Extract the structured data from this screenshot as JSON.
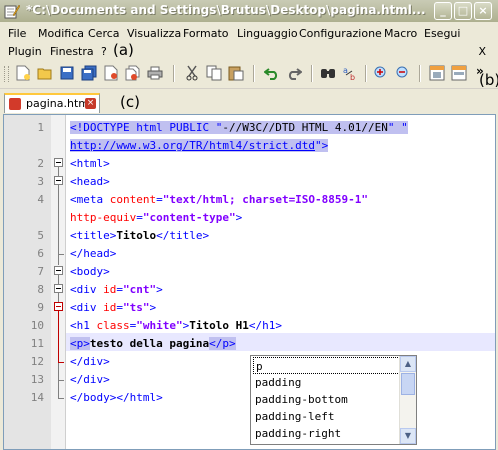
{
  "window": {
    "title": "*C:\\Documents and Settings\\Brutus\\Desktop\\pagina.html..."
  },
  "menu": {
    "items": [
      "File",
      "Modifica",
      "Cerca",
      "Visualizza",
      "Formato",
      "Linguaggio",
      "Configurazione",
      "Macro",
      "Esegui",
      "Plugin",
      "Finestra",
      "?"
    ],
    "close_label": "X"
  },
  "annotations": {
    "a": "(a)",
    "b": "(b)",
    "c": "(c)"
  },
  "toolbar": {
    "icons": [
      "new-file-icon",
      "open-folder-icon",
      "save-icon",
      "save-all-icon",
      "close-icon",
      "close-all-icon",
      "print-icon",
      "cut-icon",
      "copy-icon",
      "paste-icon",
      "undo-icon",
      "redo-icon",
      "find-icon",
      "replace-icon",
      "zoom-in-icon",
      "zoom-out-icon",
      "sync-v-icon",
      "sync-h-icon"
    ],
    "overflow": "»"
  },
  "tab": {
    "name": "pagina.html",
    "close": "×"
  },
  "editor": {
    "line_numbers": [
      "1",
      "2",
      "3",
      "4",
      "5",
      "6",
      "7",
      "8",
      "9",
      "10",
      "11",
      "12",
      "13",
      "14"
    ],
    "lines": {
      "l1a": "<!DOCTYPE html PUBLIC \"",
      "l1b": "-//W3C//DTD HTML 4.01//EN",
      "l1c": "\" \"",
      "l1d": "http://www.w3.org/TR/html4/strict.dtd",
      "l1e": "\">",
      "l2": "<html>",
      "l3": "<head>",
      "l4a": "<meta ",
      "l4b": "content",
      "l4c": "=",
      "l4d": "\"text/html; charset=ISO-8859-1\"",
      "l4e": "http-equiv",
      "l4f": "=",
      "l4g": "\"content-type\"",
      "l4h": ">",
      "l5a": "<title>",
      "l5b": "Titolo",
      "l5c": "</title>",
      "l6": "</head>",
      "l7": "<body>",
      "l8a": "<div ",
      "l8b": "id",
      "l8c": "=",
      "l8d": "\"cnt\"",
      "l8e": ">",
      "l9a": "<div ",
      "l9b": "id",
      "l9c": "=",
      "l9d": "\"ts\"",
      "l9e": ">",
      "l10a": "<h1 ",
      "l10b": "class",
      "l10c": "=",
      "l10d": "\"white\"",
      "l10e": ">",
      "l10f": "Titolo H1",
      "l10g": "</h1>",
      "l11a": "<p>",
      "l11b": "testo della pagina",
      "l11c": "</p>",
      "l12": "</div>",
      "l13": "</div>",
      "l14": "</body></html>"
    }
  },
  "autocomplete": {
    "options": [
      "p",
      "padding",
      "padding-bottom",
      "padding-left",
      "padding-right"
    ],
    "selected": "p"
  }
}
